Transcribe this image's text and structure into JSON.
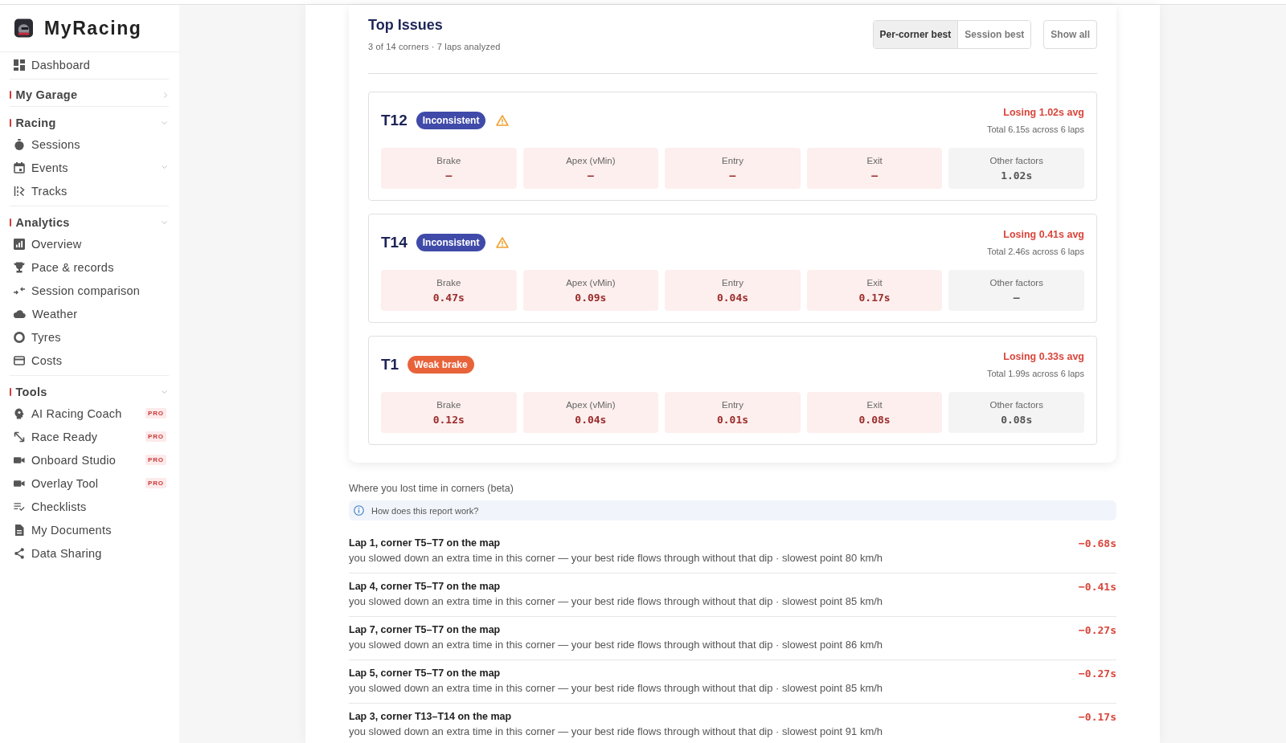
{
  "sidebar": {
    "brand": "MyRacing",
    "sections": [
      {
        "kind": "link",
        "label": "Dashboard"
      },
      {
        "kind": "group",
        "label": "My Garage",
        "expanded": false
      },
      {
        "kind": "group",
        "label": "Racing",
        "expanded": true,
        "items": [
          {
            "label": "Sessions",
            "submenu": false
          },
          {
            "label": "Events",
            "submenu": true
          },
          {
            "label": "Tracks",
            "submenu": false
          }
        ]
      },
      {
        "kind": "group",
        "label": "Analytics",
        "expanded": true,
        "items": [
          {
            "label": "Overview",
            "submenu": false
          },
          {
            "label": "Pace & records",
            "submenu": false
          },
          {
            "label": "Session comparison",
            "submenu": false
          },
          {
            "label": "Weather",
            "submenu": false
          },
          {
            "label": "Tyres",
            "submenu": false
          },
          {
            "label": "Costs",
            "submenu": false
          }
        ]
      },
      {
        "kind": "group",
        "label": "Tools",
        "expanded": true,
        "items": [
          {
            "label": "AI Racing Coach",
            "submenu": false,
            "badge": "PRO"
          },
          {
            "label": "Race Ready",
            "submenu": false,
            "badge": "PRO"
          },
          {
            "label": "Onboard Studio",
            "submenu": false,
            "badge": "PRO"
          },
          {
            "label": "Overlay Tool",
            "submenu": false,
            "badge": "PRO"
          },
          {
            "label": "Checklists",
            "submenu": false
          },
          {
            "label": "My Documents",
            "submenu": false
          },
          {
            "label": "Data Sharing",
            "submenu": false
          }
        ]
      }
    ]
  },
  "top_issues": {
    "title": "Top Issues",
    "subtitle": "3 of 14 corners · 7 laps analyzed",
    "baseline": [
      {
        "label": "Per-corner best",
        "selected": true
      },
      {
        "label": "Session best",
        "selected": false
      }
    ],
    "show_all": "Show all",
    "issues": [
      {
        "corner": "T12",
        "badge": {
          "label": "Inconsistent",
          "color": "#3f4aa9"
        },
        "warning": true,
        "loss": "Losing 1.02s avg",
        "total": "Total 6.15s across 6 laps",
        "factors": [
          {
            "kind": "cause",
            "label": "Brake",
            "value": "–"
          },
          {
            "kind": "cause",
            "label": "Apex (vMin)",
            "value": "–"
          },
          {
            "kind": "cause",
            "label": "Entry",
            "value": "–"
          },
          {
            "kind": "cause",
            "label": "Exit",
            "value": "–"
          },
          {
            "kind": "other",
            "label": "Other factors",
            "value": "1.02s"
          }
        ]
      },
      {
        "corner": "T14",
        "badge": {
          "label": "Inconsistent",
          "color": "#3f4aa9"
        },
        "warning": true,
        "loss": "Losing 0.41s avg",
        "total": "Total 2.46s across 6 laps",
        "factors": [
          {
            "kind": "cause",
            "label": "Brake",
            "value": "0.47s"
          },
          {
            "kind": "cause",
            "label": "Apex (vMin)",
            "value": "0.09s"
          },
          {
            "kind": "cause",
            "label": "Entry",
            "value": "0.04s"
          },
          {
            "kind": "cause",
            "label": "Exit",
            "value": "0.17s"
          },
          {
            "kind": "other",
            "label": "Other factors",
            "value": "–"
          }
        ]
      },
      {
        "corner": "T1",
        "badge": {
          "label": "Weak brake",
          "color": "#e8623a"
        },
        "warning": false,
        "loss": "Losing 0.33s avg",
        "total": "Total 1.99s across 6 laps",
        "factors": [
          {
            "kind": "cause",
            "label": "Brake",
            "value": "0.12s"
          },
          {
            "kind": "cause",
            "label": "Apex (vMin)",
            "value": "0.04s"
          },
          {
            "kind": "cause",
            "label": "Entry",
            "value": "0.01s"
          },
          {
            "kind": "cause",
            "label": "Exit",
            "value": "0.08s"
          },
          {
            "kind": "other",
            "label": "Other factors",
            "value": "0.08s"
          }
        ]
      }
    ]
  },
  "lost_time": {
    "title": "Where you lost time in corners (beta)",
    "help": "How does this report work?",
    "rows": [
      {
        "title": "Lap 1, corner T5–T7 on the map",
        "detail": "you slowed down an extra time in this corner — your best ride flows through without that dip · slowest point 80 km/h",
        "delta": "−0.68s"
      },
      {
        "title": "Lap 4, corner T5–T7 on the map",
        "detail": "you slowed down an extra time in this corner — your best ride flows through without that dip · slowest point 85 km/h",
        "delta": "−0.41s"
      },
      {
        "title": "Lap 7, corner T5–T7 on the map",
        "detail": "you slowed down an extra time in this corner — your best ride flows through without that dip · slowest point 86 km/h",
        "delta": "−0.27s"
      },
      {
        "title": "Lap 5, corner T5–T7 on the map",
        "detail": "you slowed down an extra time in this corner — your best ride flows through without that dip · slowest point 85 km/h",
        "delta": "−0.27s"
      },
      {
        "title": "Lap 3, corner T13–T14 on the map",
        "detail": "you slowed down an extra time in this corner — your best ride flows through without that dip · slowest point 91 km/h",
        "delta": "−0.17s"
      }
    ]
  }
}
